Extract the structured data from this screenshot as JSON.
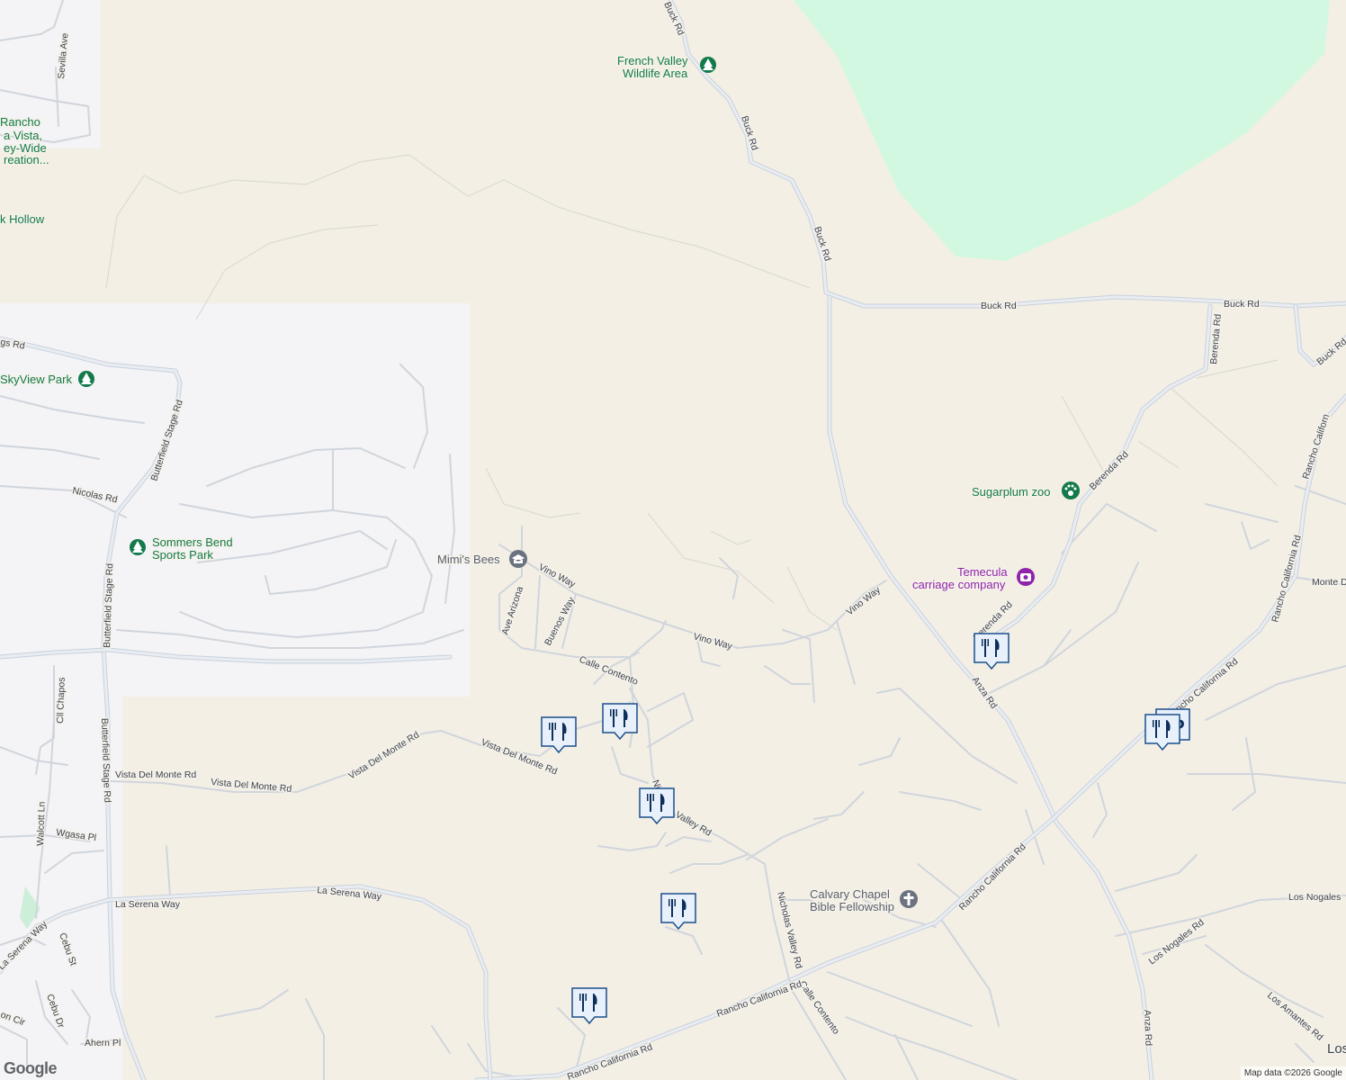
{
  "colors": {
    "land": "#f3efe5",
    "urban": "#f4f3f5",
    "park": "#d3f8e2",
    "road_casing": "#c9d1dc",
    "road_fill": "#e9edf2",
    "label": "#3d4350",
    "poi_green": "#137a4b",
    "poi_purple": "#8e24aa",
    "marker": "#1a4f8b"
  },
  "roads": {
    "buck_rd_1": "Buck Rd",
    "buck_rd_2": "Buck Rd",
    "buck_rd_3": "Buck Rd",
    "buck_rd_4": "Buck Rd",
    "buck_rd_5": "Buck Rd",
    "buck_rd_6": "Buck Rd",
    "berenda_rd_1": "Berenda Rd",
    "berenda_rd_2": "Berenda Rd",
    "berenda_rd_3": "Berenda Rd",
    "sevilla_ave": "Sevilla Ave",
    "butterfield_1": "Butterfield Stage Rd",
    "butterfield_2": "Butterfield Stage Rd",
    "butterfield_3": "Butterfield Stage Rd",
    "nicolas_rd": "Nicolas Rd",
    "murrieta_hot_springs": "gs Rd",
    "vino_way_1": "Vino Way",
    "vino_way_2": "Vino Way",
    "vino_way_3": "Vino Way",
    "ave_arizona": "Ave Arizona",
    "buenos_way": "Buenos Way",
    "calle_contento_1": "Calle Contento",
    "calle_contento_2": "Calle Contento",
    "vista_del_monte_1": "Vista Del Monte Rd",
    "vista_del_monte_2": "Vista Del Monte Rd",
    "vista_del_monte_3": "Vista Del Monte Rd",
    "vista_del_monte_4": "Vista Del Monte Rd",
    "nicholas_valley_1": "Ni",
    "nicholas_valley_2": "Valley Rd",
    "nicholas_valley_3": "Nicholas Valley Rd",
    "cll_chapos": "Cll Chapos",
    "walcott_ln": "Walcott Ln",
    "wgasa_pl": "Wgasa Pl",
    "la_serena_1": "La Serena Way",
    "la_serena_2": "La Serena Way",
    "la_serena_3": "La Serena Way",
    "cebu_st": "Cebu St",
    "cebu_dr": "Cebu Dr",
    "ahern_pl": "Ahern Pl",
    "on_cir": "on Cir",
    "rancho_california_1": "Rancho California Rd",
    "rancho_california_2": "Rancho California Rd",
    "rancho_california_3": "Rancho California Rd",
    "rancho_california_4": "Rancho California Rd",
    "rancho_california_5": "Rancho California Rd",
    "rancho_california_6": "Rancho Californ",
    "anza_rd_1": "Anza Rd",
    "anza_rd_2": "Anza Rd",
    "monte_de": "Monte De",
    "los_nogales_1": "Los Nogales Rd",
    "los_nogales_2": "Los Nogales",
    "los_amantes": "Los Amantes Rd",
    "los": "Los"
  },
  "pois": {
    "french_valley_1": "French Valley",
    "french_valley_2": "Wildlife Area",
    "rancho_1": "Rancho",
    "rancho_2": "a Vista,",
    "rancho_3": "ey-Wide",
    "rancho_4": "reation...",
    "hollow": "k Hollow",
    "skyview": "SkyView Park",
    "sommers_1": "Sommers Bend",
    "sommers_2": "Sports Park",
    "mimis_bees": "Mimi's Bees",
    "sugarplum": "Sugarplum zoo",
    "temecula_1": "Temecula",
    "temecula_2": "carriage company",
    "calvary_1": "Calvary Chapel",
    "calvary_2": "Bible Fellowship"
  },
  "icons": {
    "park": "tree-icon",
    "school": "graduation-cap-icon",
    "zoo": "paw-icon",
    "attraction": "camera-icon",
    "church": "cross-icon",
    "restaurant": "fork-knife-icon",
    "parking": "parking-icon"
  },
  "footer": {
    "attribution": "Map data ©2026 Google",
    "logo": "Google"
  }
}
